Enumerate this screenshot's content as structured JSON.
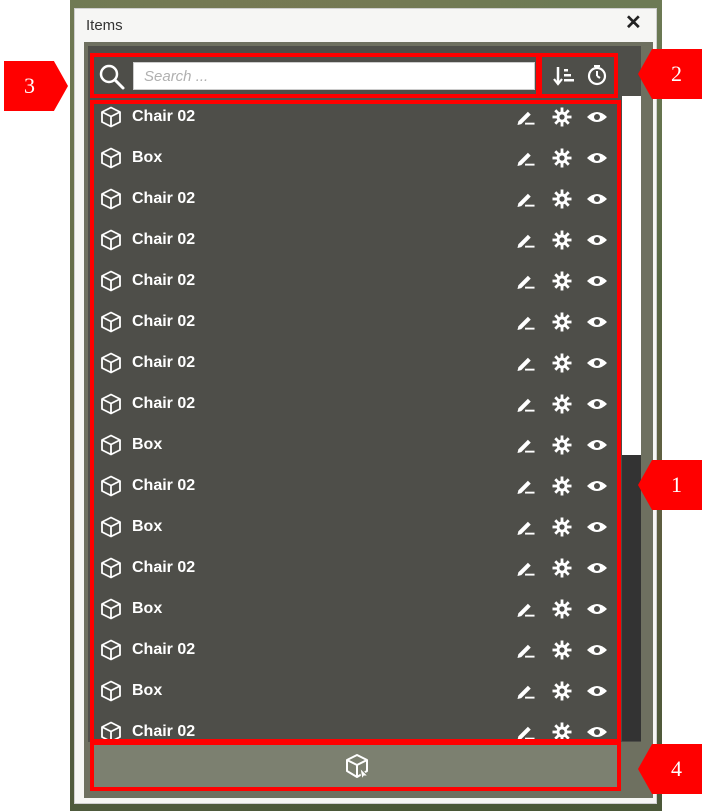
{
  "window": {
    "title": "Items",
    "close_glyph": "✕"
  },
  "search": {
    "placeholder": "Search ...",
    "value": ""
  },
  "toolbar": {
    "sort_icon": "sort-icon",
    "history_icon": "history-icon"
  },
  "items": [
    {
      "label": "Chair 02"
    },
    {
      "label": "Box"
    },
    {
      "label": "Chair 02"
    },
    {
      "label": "Chair 02"
    },
    {
      "label": "Chair 02"
    },
    {
      "label": "Chair 02"
    },
    {
      "label": "Chair 02"
    },
    {
      "label": "Chair 02"
    },
    {
      "label": "Box"
    },
    {
      "label": "Chair 02"
    },
    {
      "label": "Box"
    },
    {
      "label": "Chair 02"
    },
    {
      "label": "Box"
    },
    {
      "label": "Chair 02"
    },
    {
      "label": "Box"
    },
    {
      "label": "Chair 02"
    }
  ],
  "row_icons": [
    "cube-icon",
    "edit-icon",
    "gear-icon",
    "eye-icon"
  ],
  "bottom_button": {
    "icon": "add-item-icon"
  },
  "annotations": [
    {
      "id": "1"
    },
    {
      "id": "2"
    },
    {
      "id": "3"
    },
    {
      "id": "4"
    }
  ],
  "colors": {
    "highlight": "#ff0000",
    "panel": "#6e7060",
    "list_bg": "#4b4b48",
    "text": "#ffffff"
  }
}
